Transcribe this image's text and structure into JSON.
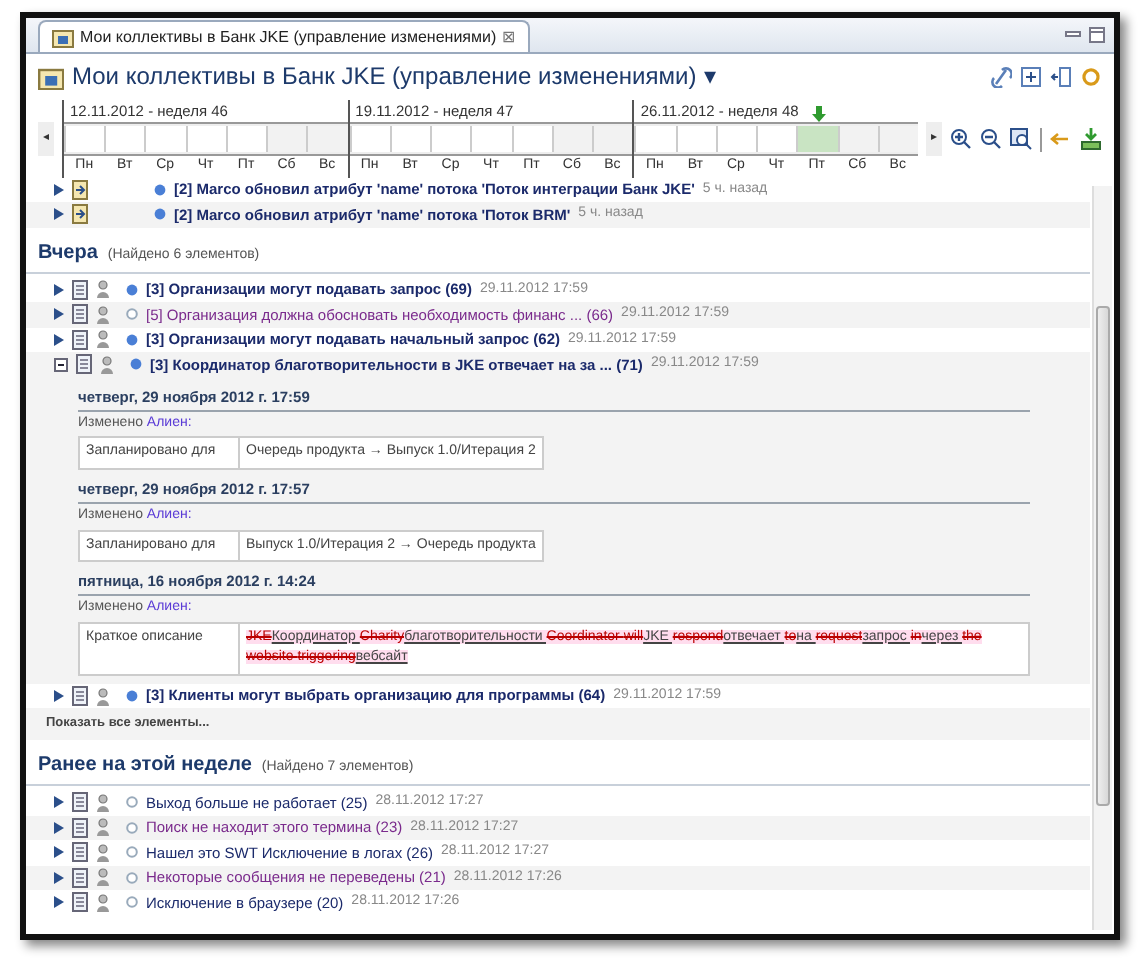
{
  "tab": {
    "title": "Мои коллективы в Банк JKE (управление изменениями)",
    "close": "⊠"
  },
  "header": {
    "title": "Мои коллективы в Банк JKE (управление изменениями)",
    "menu_caret": "▾"
  },
  "timeline": {
    "scroll_left": "◂",
    "scroll_right": "▸",
    "weeks": [
      {
        "label": "12.11.2012 - неделя 46",
        "days": [
          {
            "label": "Пн",
            "today": false
          },
          {
            "label": "Вт",
            "today": false
          },
          {
            "label": "Ср",
            "today": false
          },
          {
            "label": "Чт",
            "today": false
          },
          {
            "label": "Пт",
            "today": false
          },
          {
            "label": "Сб",
            "today": false
          },
          {
            "label": "Вс",
            "today": false
          }
        ]
      },
      {
        "label": "19.11.2012 - неделя 47",
        "days": [
          {
            "label": "Пн",
            "today": false
          },
          {
            "label": "Вт",
            "today": false
          },
          {
            "label": "Ср",
            "today": false
          },
          {
            "label": "Чт",
            "today": false
          },
          {
            "label": "Пт",
            "today": false
          },
          {
            "label": "Сб",
            "today": false
          },
          {
            "label": "Вс",
            "today": false
          }
        ]
      },
      {
        "label": "26.11.2012 - неделя 48",
        "days": [
          {
            "label": "Пн",
            "today": false
          },
          {
            "label": "Вт",
            "today": false
          },
          {
            "label": "Ср",
            "today": false
          },
          {
            "label": "Чт",
            "today": false
          },
          {
            "label": "Пт",
            "today": true
          },
          {
            "label": "Сб",
            "today": false
          },
          {
            "label": "Вс",
            "today": false
          }
        ]
      }
    ]
  },
  "recent": [
    {
      "title": "[2] Marco обновил атрибут 'name' потока 'Поток интеграции Банк JKE'",
      "time": "5 ч. назад"
    },
    {
      "title": "[2] Marco обновил атрибут 'name' потока 'Поток BRM'",
      "time": "5 ч. назад"
    }
  ],
  "sections": [
    {
      "title": "Вчера",
      "count": "(Найдено 6 элементов)",
      "show_all": "Показать все элементы...",
      "items": [
        {
          "title": "[3] Организации могут подавать запрос (69)",
          "date": "29.11.2012 17:59",
          "unread": true,
          "visited": false,
          "expanded": false
        },
        {
          "title": "[5] Организация должна обосновать необходимость финанс ... (66)",
          "date": "29.11.2012 17:59",
          "unread": false,
          "visited": true,
          "expanded": false
        },
        {
          "title": "[3] Организации могут подавать начальный запрос (62)",
          "date": "29.11.2012 17:59",
          "unread": true,
          "visited": false,
          "expanded": false
        },
        {
          "title": "[3] Координатор благотворительности в JKE отвечает на за ... (71)",
          "date": "29.11.2012 17:59",
          "unread": true,
          "visited": false,
          "expanded": true,
          "changes": [
            {
              "date": "четверг, 29 ноября 2012 г. 17:59",
              "by": "Изменено",
              "author": "Алиен:",
              "field": "Запланировано для",
              "kind": "transition",
              "value": "Очередь продукта  →  Выпуск 1.0/Итерация 2"
            },
            {
              "date": "четверг, 29 ноября 2012 г. 17:57",
              "by": "Изменено",
              "author": "Алиен:",
              "field": "Запланировано для",
              "kind": "transition",
              "value": "Выпуск 1.0/Итерация 2  →  Очередь продукта"
            },
            {
              "date": "пятница, 16 ноября 2012 г. 14:24",
              "by": "Изменено",
              "author": "Алиен:",
              "field": "Краткое описание",
              "kind": "diff",
              "segments": [
                {
                  "kind": "del",
                  "text": "JKE"
                },
                {
                  "kind": "ins",
                  "text": "Координатор "
                },
                {
                  "kind": "del",
                  "text": "Charity"
                },
                {
                  "kind": "ins",
                  "text": "благотворительности "
                },
                {
                  "kind": "del",
                  "text": "Coordinator "
                },
                {
                  "kind": "del",
                  "text": "will"
                },
                {
                  "kind": "ins",
                  "text": "JKE "
                },
                {
                  "kind": "del",
                  "text": "respond"
                },
                {
                  "kind": "ins",
                  "text": "отвечает "
                },
                {
                  "kind": "del",
                  "text": "to"
                },
                {
                  "kind": "ins",
                  "text": "на "
                },
                {
                  "kind": "del",
                  "text": "request"
                },
                {
                  "kind": "ins",
                  "text": "запрос "
                },
                {
                  "kind": "del",
                  "text": "in"
                },
                {
                  "kind": "ins",
                  "text": "через "
                },
                {
                  "kind": "del",
                  "text": "the website "
                },
                {
                  "kind": "del",
                  "text": "triggering"
                },
                {
                  "kind": "ins",
                  "text": "вебсайт"
                }
              ]
            }
          ]
        },
        {
          "title": "[3] Клиенты могут выбрать организацию для программы (64)",
          "date": "29.11.2012 17:59",
          "unread": true,
          "visited": false,
          "expanded": false
        }
      ]
    },
    {
      "title": "Ранее на этой неделе",
      "count": "(Найдено 7 элементов)",
      "items": [
        {
          "title": "Выход больше не работает (25)",
          "date": "28.11.2012 17:27",
          "unread": false,
          "visited": false,
          "expanded": false
        },
        {
          "title": "Поиск не находит этого термина (23)",
          "date": "28.11.2012 17:27",
          "unread": false,
          "visited": true,
          "expanded": false
        },
        {
          "title": "Нашел это SWT Исключение в логах (26)",
          "date": "28.11.2012 17:27",
          "unread": false,
          "visited": false,
          "expanded": false
        },
        {
          "title": "Некоторые сообщения не переведены (21)",
          "date": "28.11.2012 17:26",
          "unread": false,
          "visited": true,
          "expanded": false
        },
        {
          "title": "Исключение в браузере (20)",
          "date": "28.11.2012 17:26",
          "unread": false,
          "visited": false,
          "expanded": false
        }
      ]
    }
  ]
}
